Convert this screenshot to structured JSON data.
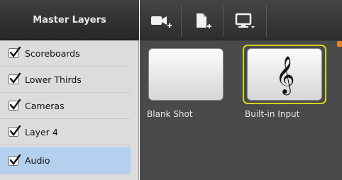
{
  "sidebar": {
    "header": "Master Layers",
    "items": [
      {
        "label": "Scoreboards",
        "checked": true,
        "selected": false
      },
      {
        "label": "Lower Thirds",
        "checked": true,
        "selected": false
      },
      {
        "label": "Cameras",
        "checked": true,
        "selected": false
      },
      {
        "label": "Layer 4",
        "checked": true,
        "selected": false
      },
      {
        "label": "Audio",
        "checked": true,
        "selected": true
      }
    ]
  },
  "toolbar": {
    "buttons": [
      {
        "icon": "add-camera-icon"
      },
      {
        "icon": "add-document-icon"
      },
      {
        "icon": "display-menu-icon"
      }
    ]
  },
  "shots": [
    {
      "label": "Blank Shot",
      "icon": "",
      "live": false
    },
    {
      "label": "Built-in Input",
      "icon": "treble-clef-icon",
      "live": true
    }
  ],
  "colors": {
    "selected_row": "#b4d0ef",
    "live_border": "#d7d21e",
    "header_bg": "#2e2e2e"
  }
}
